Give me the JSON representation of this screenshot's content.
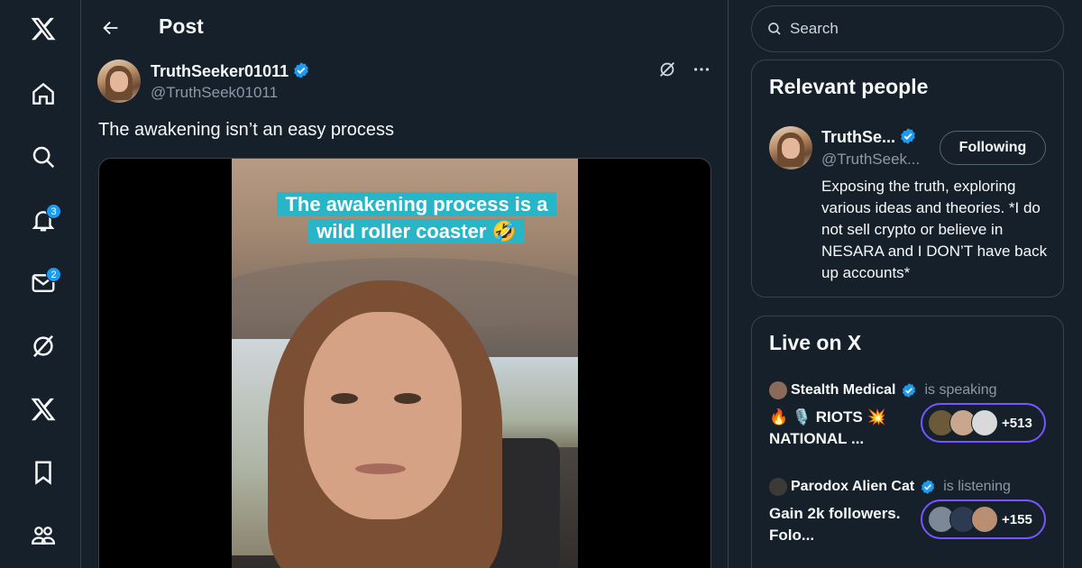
{
  "nav": {
    "notifications_badge": "3",
    "messages_badge": "2"
  },
  "header": {
    "title": "Post"
  },
  "post": {
    "author_name": "TruthSeeker01011",
    "author_handle": "@TruthSeek01011",
    "text": "The awakening isn’t an easy process",
    "video_caption_line1": "The awakening process is a",
    "video_caption_line2": "wild roller coaster 🤣"
  },
  "search": {
    "placeholder": "Search"
  },
  "relevant_people": {
    "title": "Relevant people",
    "name": "TruthSe...",
    "handle": "@TruthSeek...",
    "follow_label": "Following",
    "bio": "Exposing the truth, exploring various ideas and theories. *I do not sell crypto or believe in NESARA and I DON’T have back up accounts*"
  },
  "live": {
    "title": "Live on X",
    "items": [
      {
        "host": "Stealth Medical",
        "status": "is speaking",
        "title": "🔥 🎙️ RIOTS 💥 NATIONAL ...",
        "count": "+513"
      },
      {
        "host": "Parodox Alien Cat",
        "status": "is listening",
        "title": "Gain 2k followers. Folo...",
        "count": "+155"
      }
    ]
  },
  "colors": {
    "background": "#15202b",
    "border": "#38444d",
    "accent": "#1d9bf0",
    "spaces_purple": "#7856ff",
    "muted_text": "#8b98a5"
  }
}
